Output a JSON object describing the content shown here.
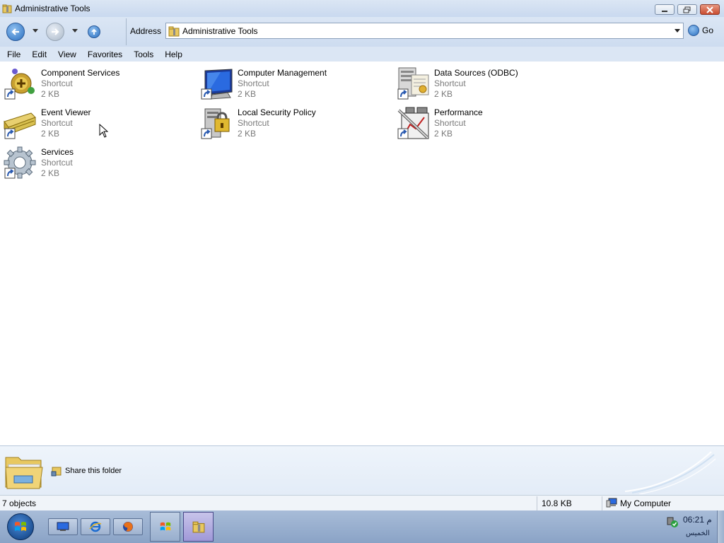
{
  "window": {
    "title": "Administrative Tools"
  },
  "navigation": {
    "address_label": "Address",
    "address_value": "Administrative Tools",
    "go_label": "Go"
  },
  "menu": [
    "File",
    "Edit",
    "View",
    "Favorites",
    "Tools",
    "Help"
  ],
  "files": [
    {
      "name": "Component Services",
      "type": "Shortcut",
      "size": "2 KB",
      "icon": "component-services-icon"
    },
    {
      "name": "Computer Management",
      "type": "Shortcut",
      "size": "2 KB",
      "icon": "computer-management-icon"
    },
    {
      "name": "Data Sources (ODBC)",
      "type": "Shortcut",
      "size": "2 KB",
      "icon": "data-sources-icon"
    },
    {
      "name": "Event Viewer",
      "type": "Shortcut",
      "size": "2 KB",
      "icon": "event-viewer-icon"
    },
    {
      "name": "Local Security Policy",
      "type": "Shortcut",
      "size": "2 KB",
      "icon": "local-security-policy-icon"
    },
    {
      "name": "Performance",
      "type": "Shortcut",
      "size": "2 KB",
      "icon": "performance-icon"
    },
    {
      "name": "Services",
      "type": "Shortcut",
      "size": "2 KB",
      "icon": "services-icon"
    }
  ],
  "details": {
    "task_label": "Share this folder"
  },
  "status": {
    "object_count": "7 objects",
    "total_size": "10.8 KB",
    "location": "My Computer"
  },
  "taskbar": {
    "time": "06:21 م",
    "date_label": "الخميس"
  },
  "colors": {
    "chrome": "#dbe6f4",
    "accent": "#2a6fc0",
    "secondary_text": "#7a7a7a"
  }
}
